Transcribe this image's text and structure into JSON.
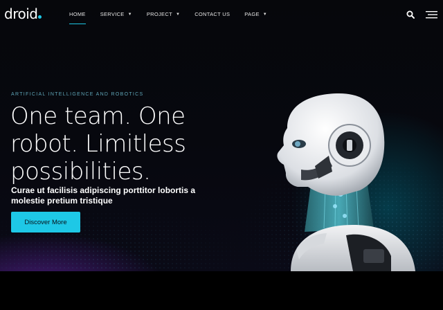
{
  "brand": {
    "name": "droid",
    "accent": "#1ec8e6"
  },
  "nav": {
    "items": [
      {
        "label": "HOME",
        "active": true
      },
      {
        "label": "SERVICE",
        "dropdown": true
      },
      {
        "label": "PROJECT",
        "dropdown": true
      },
      {
        "label": "CONTACT US"
      },
      {
        "label": "PAGE",
        "dropdown": true
      }
    ],
    "icons": [
      "search-icon",
      "hamburger-menu-icon"
    ]
  },
  "hero": {
    "eyebrow": "ARTIFICIAL INTELLIGENCE AND ROBOTICS",
    "headline": "One team. One robot. Limitless possibilities.",
    "subline": "Curae ut facilisis adipiscing porttitor lobortis a molestie pretium tristique",
    "cta_label": "Discover More",
    "image": "robot-head-illustration"
  },
  "colors": {
    "background": "#000000",
    "button": "#1ec8e6",
    "eyebrow": "#5fa6b8"
  }
}
